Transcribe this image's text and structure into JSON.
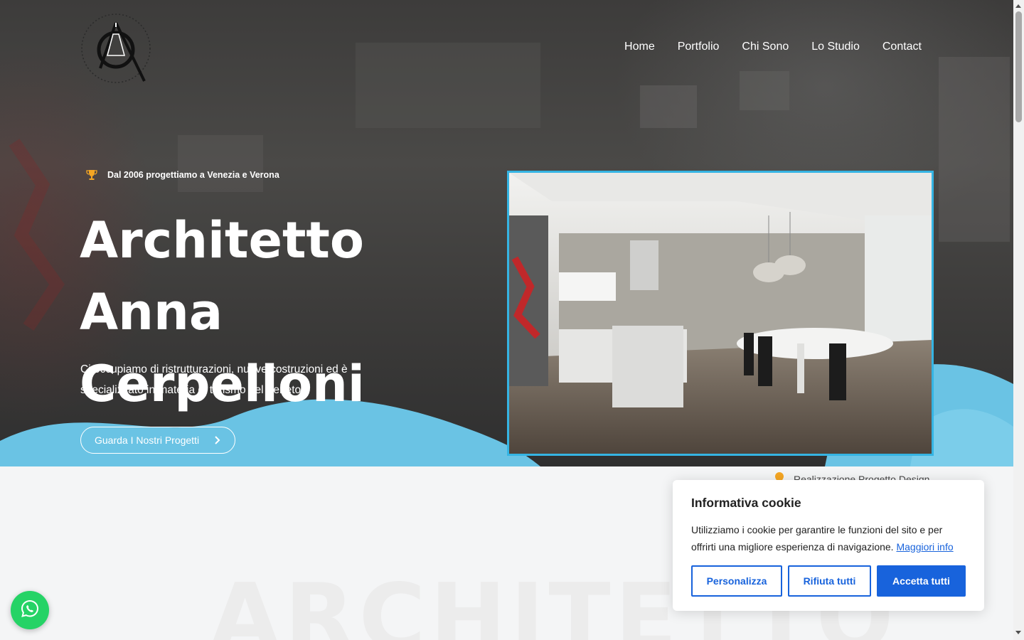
{
  "nav": {
    "items": [
      "Home",
      "Portfolio",
      "Chi Sono",
      "Lo Studio",
      "Contact"
    ]
  },
  "hero": {
    "badge_icon": "trophy-icon",
    "badge_text": "Dal 2006 progettiamo a Venezia e Verona",
    "title_line1": "Architetto Anna",
    "title_line2": "Cerpelloni",
    "subtitle": "Ci occupiamo di  ristrutturazioni, nuove costruzioni ed è specializzato in materia di turismo del Veneto.",
    "cta_label": "Guarda I Nostri Progetti",
    "cta_icon": "chevron-right-icon"
  },
  "below": {
    "watermark_title": "ARCHITETTO",
    "partial_feature": "Realizzazione Progetto Design"
  },
  "cookie": {
    "title": "Informativa cookie",
    "text": "Utilizziamo i cookie per garantire le funzioni del sito e per offrirti una migliore esperienza di navigazione.",
    "link_label": "Maggiori info",
    "customize_label": "Personalizza",
    "reject_label": "Rifiuta tutti",
    "accept_label": "Accetta tutti"
  },
  "colors": {
    "accent_blue": "#35b4e3",
    "wave_blue": "#6cc5e6",
    "cookie_blue": "#1863dc",
    "whatsapp_green": "#25d366"
  }
}
